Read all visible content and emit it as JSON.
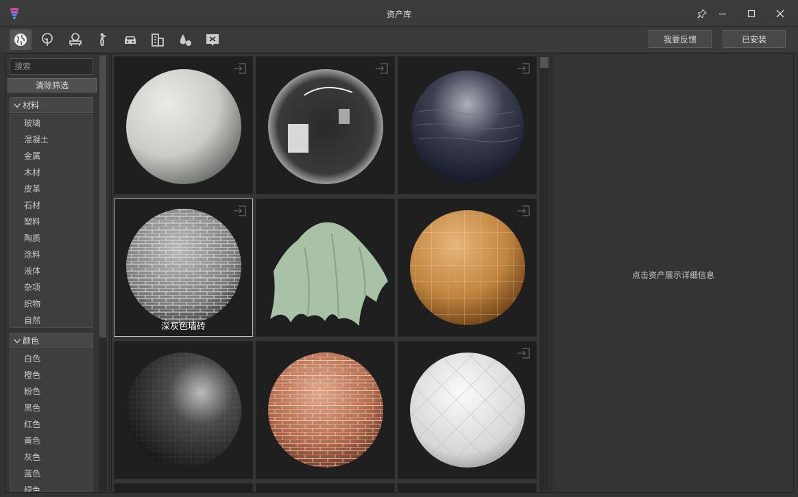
{
  "window": {
    "title": "资产库"
  },
  "toolbar": {
    "categories": [
      "world-icon",
      "plant-icon",
      "furniture-icon",
      "person-icon",
      "car-icon",
      "building-icon",
      "water-drop-icon",
      "board-icon"
    ],
    "feedback_label": "我要反馈",
    "installed_label": "已安装"
  },
  "sidebar": {
    "search_placeholder": "搜索",
    "clear_label": "清除筛选",
    "groups": [
      {
        "title": "材料",
        "items": [
          "玻璃",
          "混凝土",
          "金属",
          "木材",
          "皮革",
          "石材",
          "塑料",
          "陶质",
          "涂料",
          "液体",
          "杂项",
          "织物",
          "自然"
        ]
      },
      {
        "title": "颜色",
        "items": [
          "白色",
          "橙色",
          "粉色",
          "黑色",
          "红色",
          "黄色",
          "灰色",
          "蓝色",
          "绿色"
        ]
      }
    ]
  },
  "assets": [
    {
      "name": "white-plaster-sphere"
    },
    {
      "name": "glass-sphere"
    },
    {
      "name": "water-sphere"
    },
    {
      "name": "dark-gray-brick-sphere",
      "label": "深灰色墙砖",
      "selected": true
    },
    {
      "name": "green-cloth"
    },
    {
      "name": "orange-tile-sphere"
    },
    {
      "name": "black-mosaic-sphere"
    },
    {
      "name": "red-brick-sphere"
    },
    {
      "name": "white-diamond-tile-sphere"
    }
  ],
  "detail": {
    "message": "点击资产展示详细信息"
  },
  "colors": {
    "accent": "#8a5cf6",
    "panel": "#343434",
    "tile": "#1f1f1f"
  }
}
